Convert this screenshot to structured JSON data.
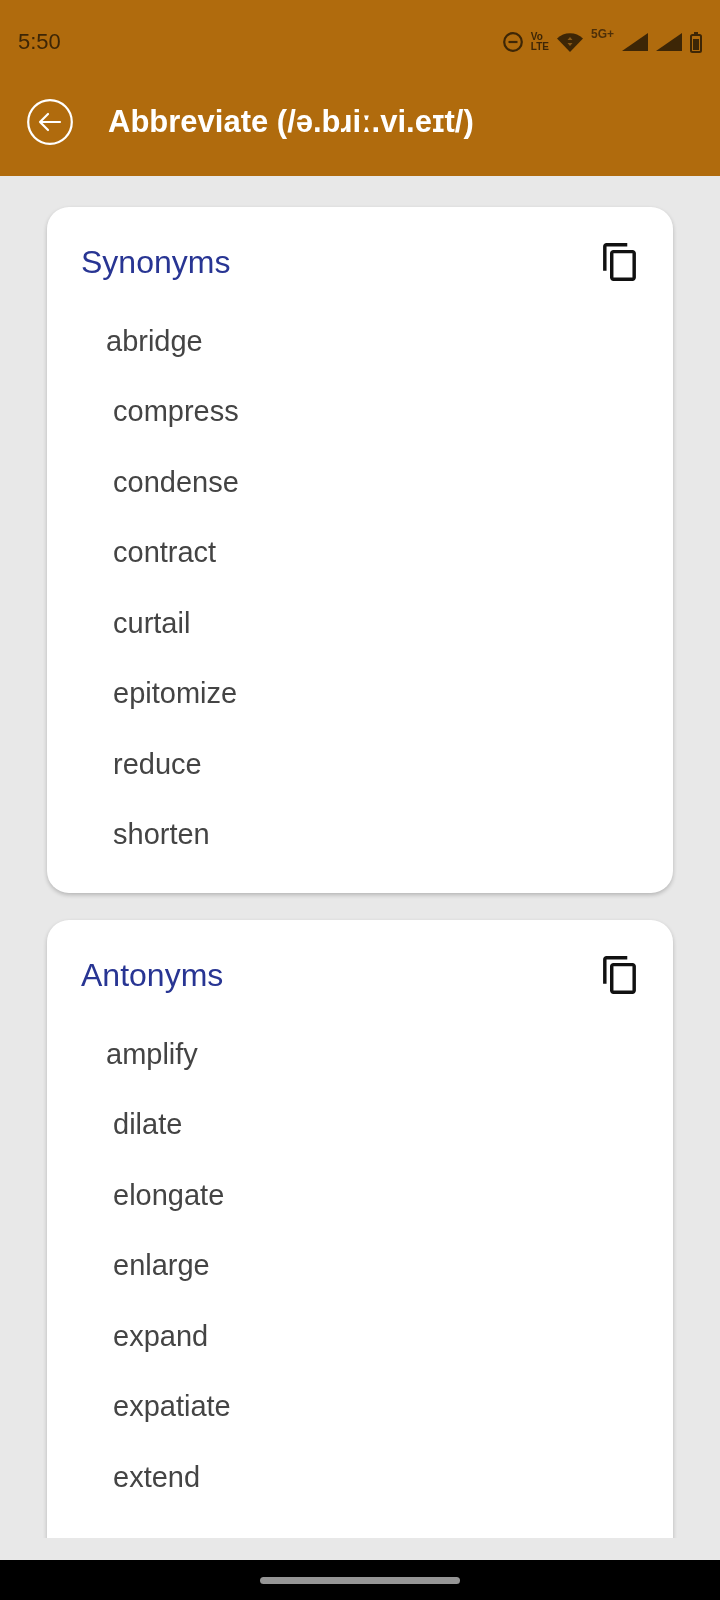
{
  "status_bar": {
    "time": "5:50",
    "volte_label": [
      "Vo",
      "LTE"
    ],
    "network_type": "5G+"
  },
  "app_bar": {
    "title": "Abbreviate (/ə.bɹiː.vi.eɪt/)"
  },
  "sections": [
    {
      "title": "Synonyms",
      "words": [
        "abridge",
        "compress",
        "condense",
        "contract",
        "curtail",
        "epitomize",
        "reduce",
        "shorten"
      ]
    },
    {
      "title": "Antonyms",
      "words": [
        "amplify",
        "dilate",
        "elongate",
        "enlarge",
        "expand",
        "expatiate",
        "extend"
      ]
    }
  ]
}
